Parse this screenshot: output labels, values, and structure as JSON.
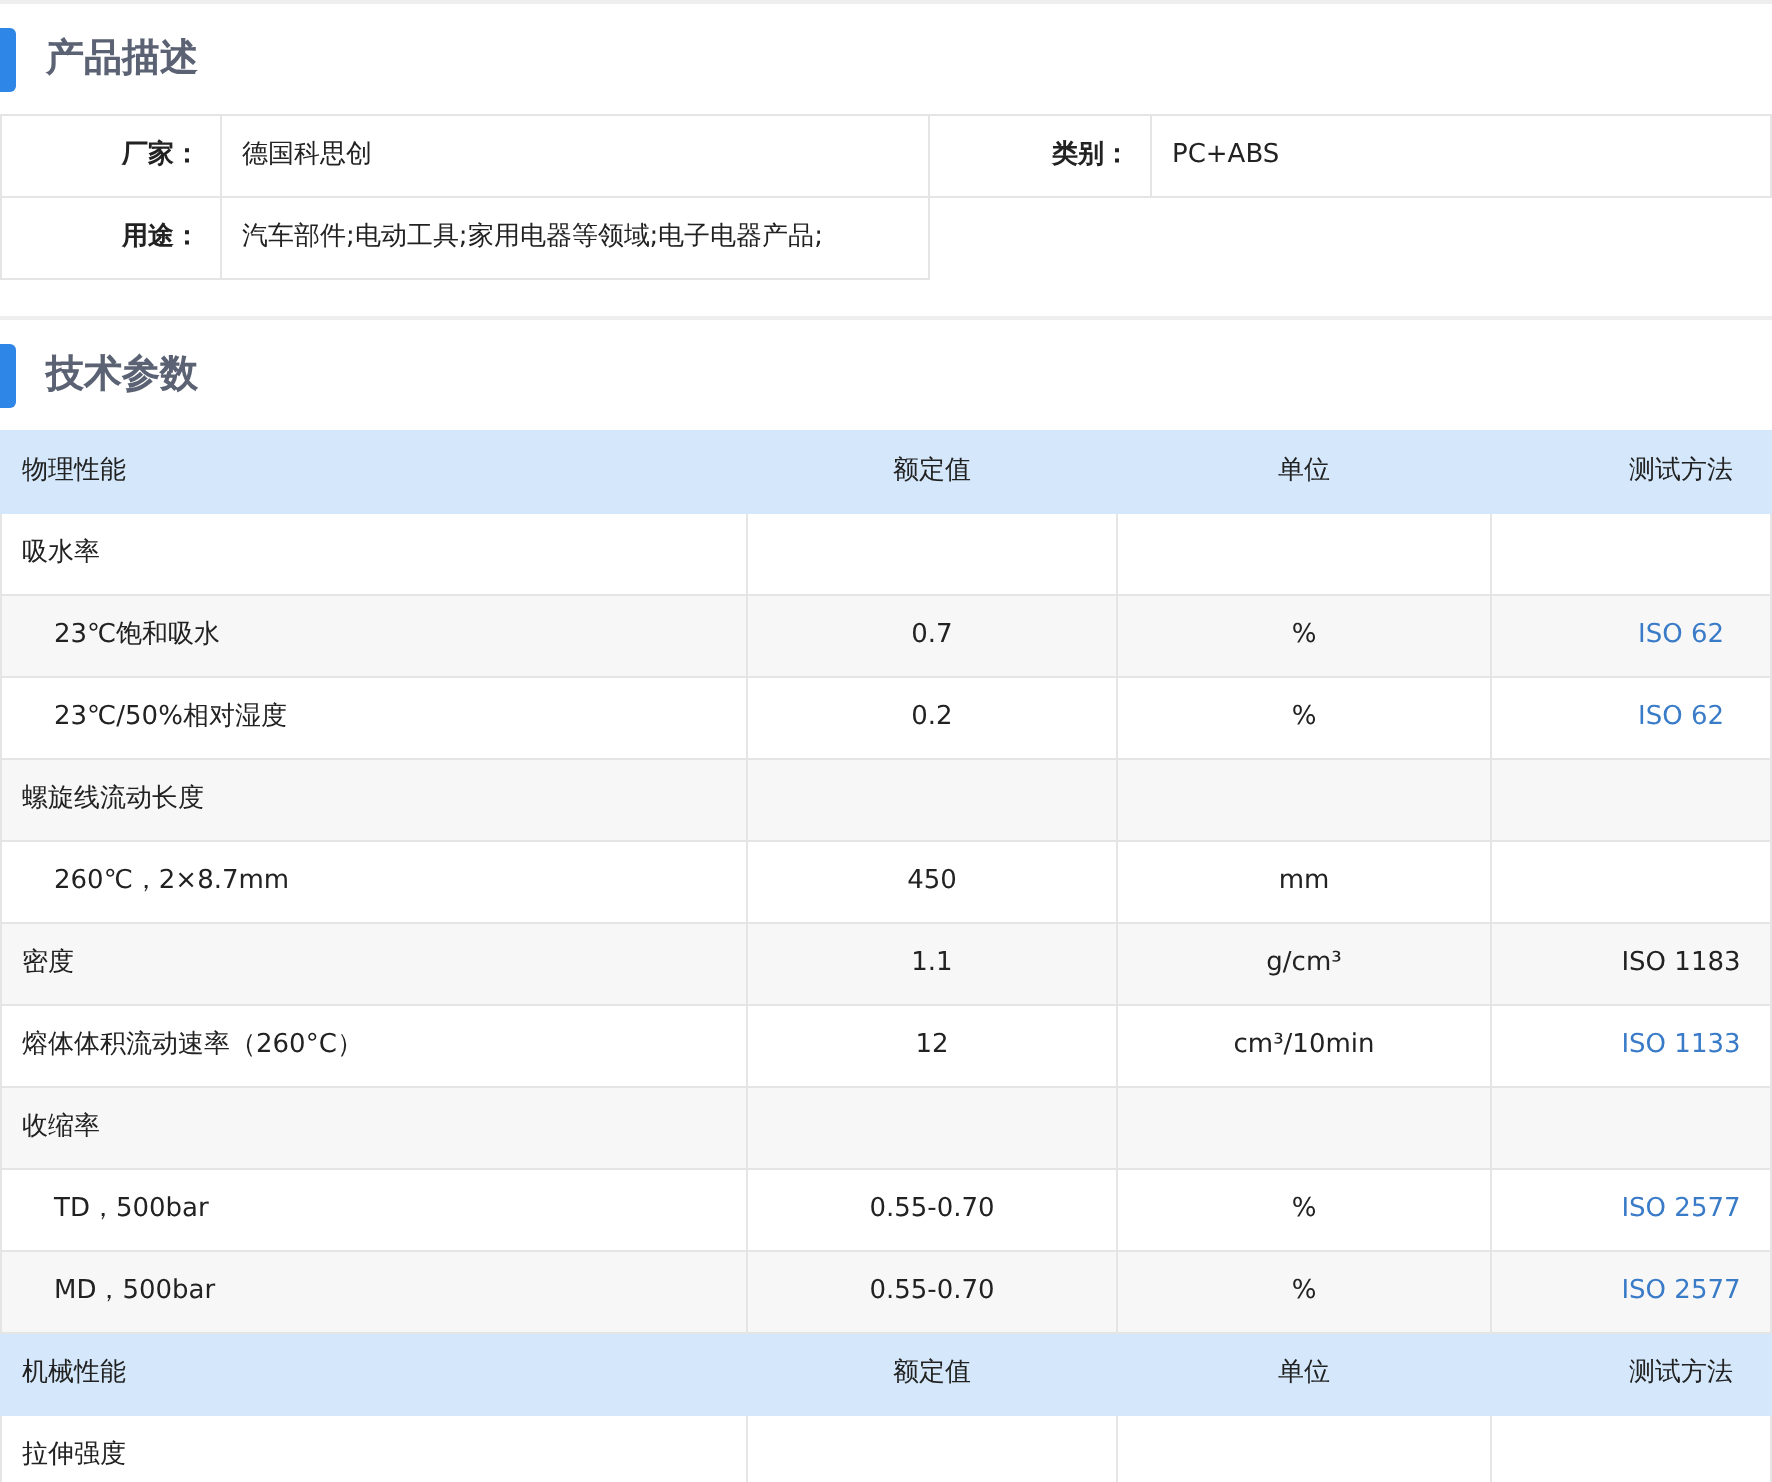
{
  "description": {
    "title": "产品描述",
    "fields": [
      {
        "label": "厂家：",
        "value": "德国科思创"
      },
      {
        "label": "类别：",
        "value": "PC+ABS"
      },
      {
        "label": "用途：",
        "value": "汽车部件;电动工具;家用电器等领域;电子电器产品;"
      }
    ]
  },
  "specs": {
    "title": "技术参数",
    "rows": [
      {
        "kind": "group",
        "cells": [
          "物理性能",
          "额定值",
          "单位",
          "测试方法"
        ]
      },
      {
        "kind": "category",
        "cells": [
          "吸水率",
          "",
          "",
          ""
        ]
      },
      {
        "kind": "sub",
        "cells": [
          "23℃饱和吸水",
          "0.7",
          "%",
          "ISO 62"
        ],
        "link": true
      },
      {
        "kind": "sub",
        "cells": [
          "23℃/50%相对湿度",
          "0.2",
          "%",
          "ISO 62"
        ],
        "link": true
      },
      {
        "kind": "category",
        "cells": [
          "螺旋线流动长度",
          "",
          "",
          ""
        ]
      },
      {
        "kind": "sub",
        "cells": [
          "260℃，2×8.7mm",
          "450",
          "mm",
          ""
        ]
      },
      {
        "kind": "category",
        "cells": [
          "密度",
          "1.1",
          "g/cm³",
          "ISO 1183"
        ],
        "link": false
      },
      {
        "kind": "category",
        "cells": [
          "熔体体积流动速率（260°C）",
          "12",
          "cm³/10min",
          "ISO 1133"
        ],
        "link": true
      },
      {
        "kind": "category",
        "cells": [
          "收缩率",
          "",
          "",
          ""
        ]
      },
      {
        "kind": "sub",
        "cells": [
          "TD，500bar",
          "0.55-0.70",
          "%",
          "ISO 2577"
        ],
        "link": true
      },
      {
        "kind": "sub",
        "cells": [
          "MD，500bar",
          "0.55-0.70",
          "%",
          "ISO 2577"
        ],
        "link": true
      },
      {
        "kind": "group",
        "cells": [
          "机械性能",
          "额定值",
          "单位",
          "测试方法"
        ]
      },
      {
        "kind": "category",
        "cells": [
          "拉伸强度",
          "",
          "",
          ""
        ]
      }
    ]
  }
}
